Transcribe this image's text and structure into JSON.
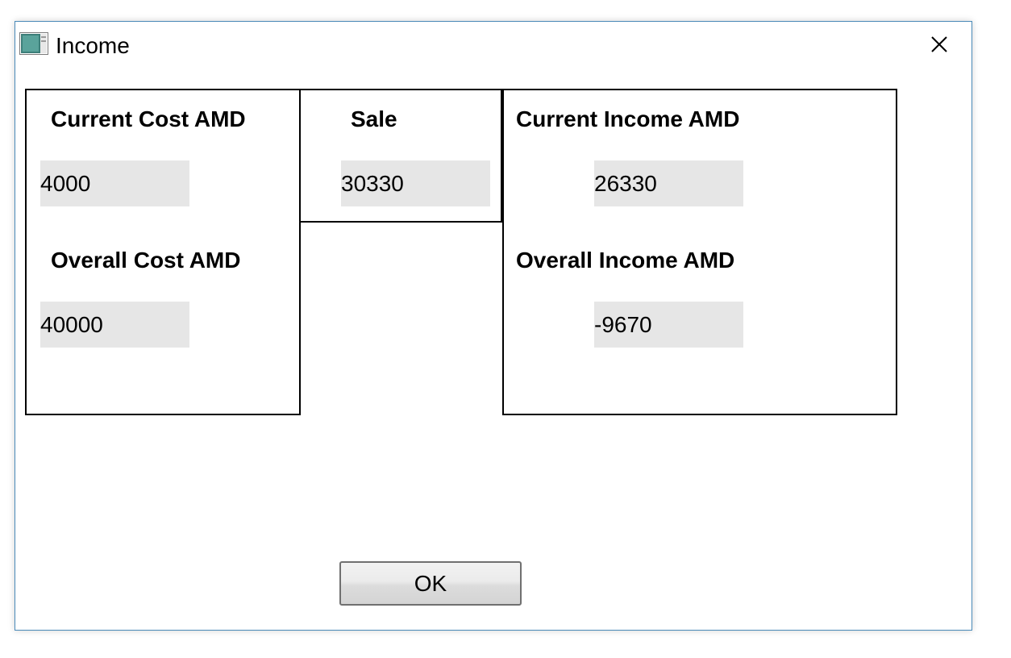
{
  "window": {
    "title": "Income",
    "icon": "window-app-icon",
    "close_icon": "close-icon"
  },
  "cost_panel": {
    "current_cost_label": "Current Cost AMD",
    "current_cost_value": "4000",
    "overall_cost_label": "Overall Cost AMD",
    "overall_cost_value": "40000"
  },
  "sale_panel": {
    "sale_label": "Sale",
    "sale_value": "30330"
  },
  "income_panel": {
    "current_income_label": "Current Income AMD",
    "current_income_value": "26330",
    "overall_income_label": "Overall Income AMD",
    "overall_income_value": "-9670"
  },
  "buttons": {
    "ok_label": "OK"
  },
  "colors": {
    "window_border": "#4a8ab8",
    "field_background": "#e6e6e6",
    "panel_border": "#000000"
  }
}
